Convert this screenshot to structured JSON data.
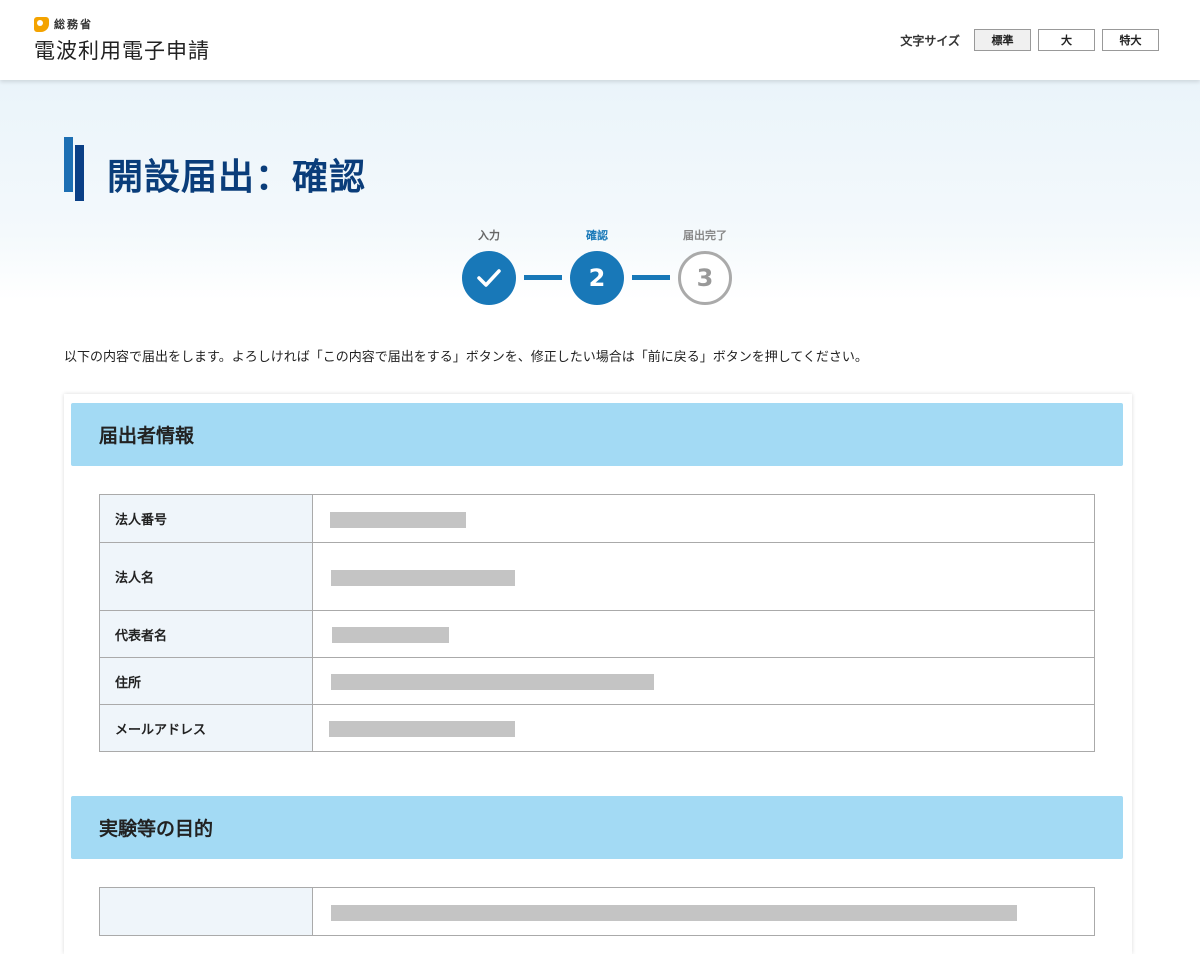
{
  "header": {
    "ministry": "総務省",
    "service_name": "電波利用電子申請",
    "font_size_label": "文字サイズ",
    "font_size_options": [
      {
        "label": "標準",
        "active": true
      },
      {
        "label": "大",
        "active": false
      },
      {
        "label": "特大",
        "active": false
      }
    ]
  },
  "page": {
    "title": "開設届出：確認",
    "intro": "以下の内容で届出をします。よろしければ「この内容で届出をする」ボタンを、修正したい場合は「前に戻る」ボタンを押してください。"
  },
  "stepper": {
    "steps": [
      {
        "label": "入力",
        "status": "done",
        "number": ""
      },
      {
        "label": "確認",
        "status": "current",
        "number": "2"
      },
      {
        "label": "届出完了",
        "status": "todo",
        "number": "3"
      }
    ]
  },
  "sections": [
    {
      "title": "届出者情報",
      "rows": [
        {
          "label": "法人番号",
          "value": "",
          "redacted": true
        },
        {
          "label": "法人名",
          "value": "",
          "redacted": true
        },
        {
          "label": "代表者名",
          "value": "",
          "redacted": true
        },
        {
          "label": "住所",
          "value": "",
          "redacted": true
        },
        {
          "label": "メールアドレス",
          "value": "",
          "redacted": true
        }
      ]
    },
    {
      "title": "実験等の目的",
      "rows": [
        {
          "label": "",
          "value": "",
          "redacted": true
        }
      ]
    }
  ],
  "colors": {
    "accent": "#1878b8",
    "title": "#0a3d7a",
    "section_head": "#a3daf4",
    "logo": "#f4a300"
  }
}
